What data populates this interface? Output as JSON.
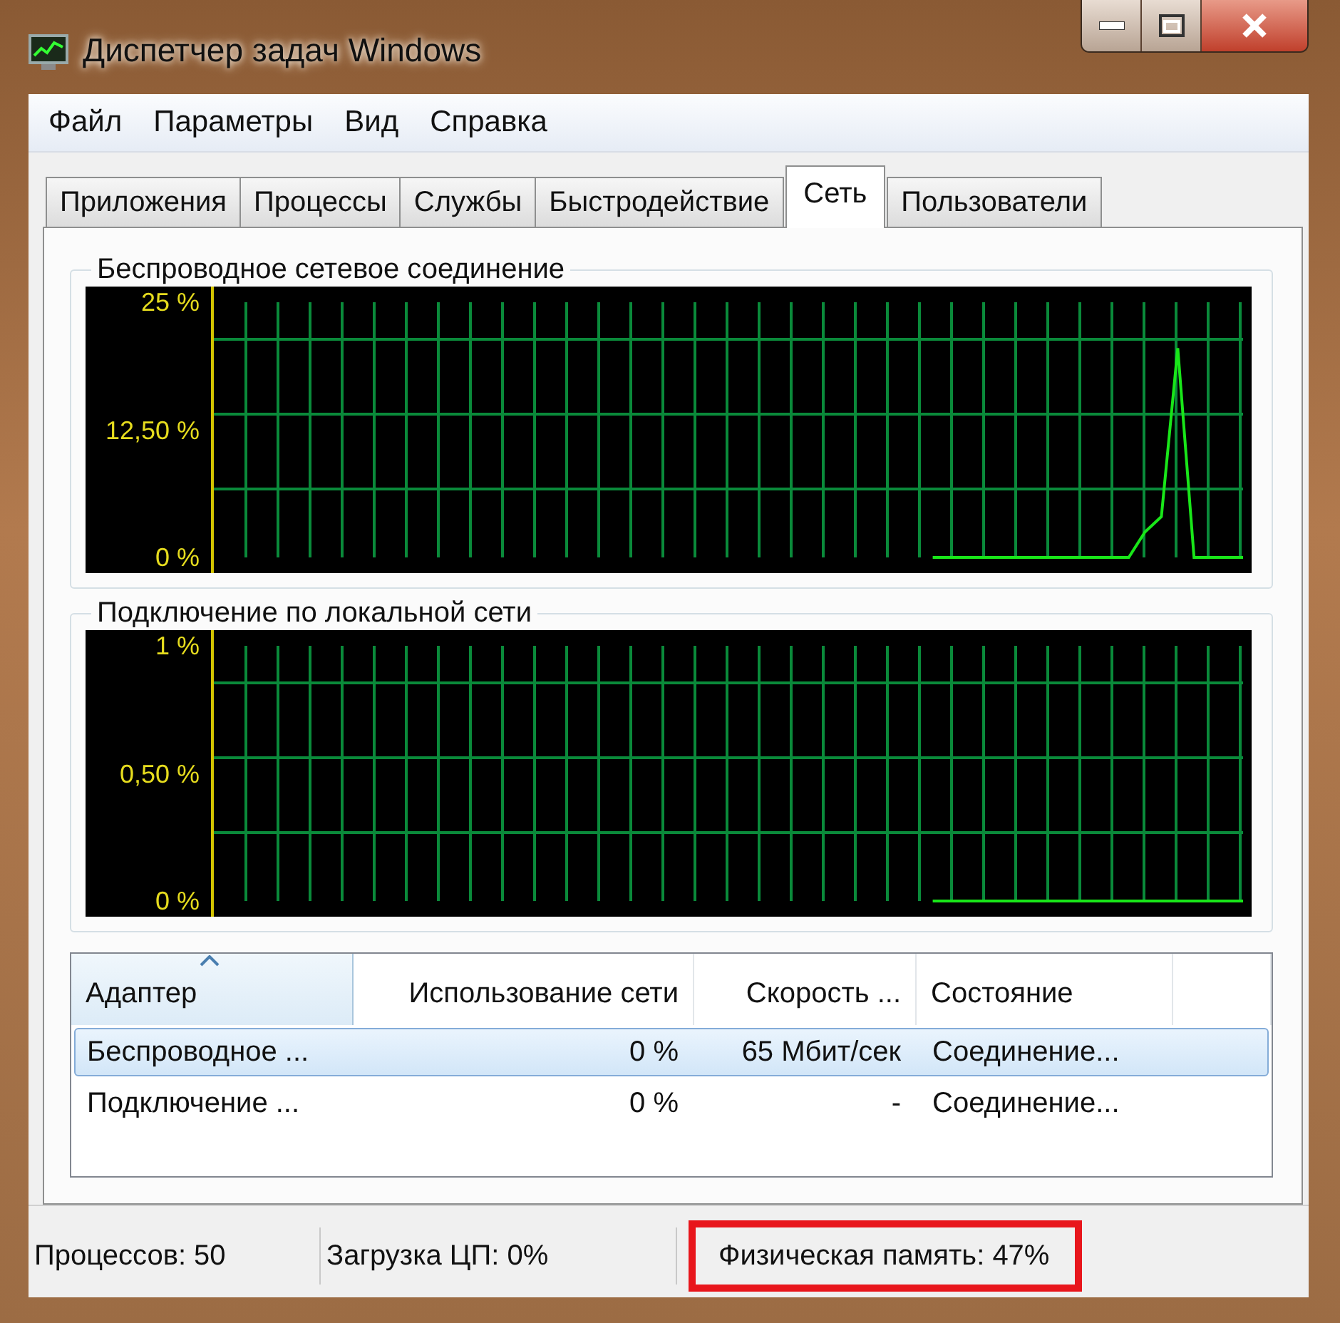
{
  "window": {
    "title": "Диспетчер задач Windows"
  },
  "menu": [
    "Файл",
    "Параметры",
    "Вид",
    "Справка"
  ],
  "tabs": [
    {
      "label": "Приложения",
      "selected": false
    },
    {
      "label": "Процессы",
      "selected": false
    },
    {
      "label": "Службы",
      "selected": false
    },
    {
      "label": "Быстродействие",
      "selected": false
    },
    {
      "label": "Сеть",
      "selected": true
    },
    {
      "label": "Пользователи",
      "selected": false
    }
  ],
  "graphs": [
    {
      "chart_data": {
        "type": "line",
        "title": "Беспроводное сетевое соединение",
        "ylim": [
          0,
          25
        ],
        "yticks": [
          {
            "value": 25,
            "label": "25 %"
          },
          {
            "value": 12.5,
            "label": "12,50 %"
          },
          {
            "value": 0,
            "label": "0 %"
          }
        ],
        "series": [
          {
            "color": "#19e619",
            "values": [
              null,
              null,
              null,
              null,
              null,
              null,
              null,
              null,
              null,
              null,
              null,
              null,
              null,
              null,
              null,
              null,
              null,
              null,
              null,
              null,
              null,
              null,
              null,
              null,
              null,
              null,
              null,
              null,
              null,
              null,
              null,
              null,
              null,
              null,
              null,
              null,
              null,
              null,
              null,
              null,
              null,
              null,
              null,
              null,
              0,
              0,
              0,
              0,
              0,
              0,
              0,
              0,
              0,
              0,
              0,
              0,
              0,
              2.5,
              4,
              20.5,
              0,
              0,
              0,
              0
            ]
          }
        ]
      }
    },
    {
      "chart_data": {
        "type": "line",
        "title": "Подключение по локальной сети",
        "ylim": [
          0,
          1
        ],
        "yticks": [
          {
            "value": 1,
            "label": "1 %"
          },
          {
            "value": 0.5,
            "label": "0,50 %"
          },
          {
            "value": 0,
            "label": "0 %"
          }
        ],
        "series": [
          {
            "color": "#19e619",
            "values": [
              null,
              null,
              null,
              null,
              null,
              null,
              null,
              null,
              null,
              null,
              null,
              null,
              null,
              null,
              null,
              null,
              null,
              null,
              null,
              null,
              null,
              null,
              null,
              null,
              null,
              null,
              null,
              null,
              null,
              null,
              null,
              null,
              null,
              null,
              null,
              null,
              null,
              null,
              null,
              null,
              null,
              null,
              null,
              null,
              0,
              0,
              0,
              0,
              0,
              0,
              0,
              0,
              0,
              0,
              0,
              0,
              0,
              0,
              0,
              0,
              0,
              0,
              0,
              0
            ]
          }
        ]
      }
    }
  ],
  "table": {
    "columns": [
      {
        "label": "Адаптер",
        "sorted": true
      },
      {
        "label": "Использование сети",
        "sorted": false
      },
      {
        "label": "Скорость ...",
        "sorted": false
      },
      {
        "label": "Состояние",
        "sorted": false
      }
    ],
    "rows": [
      {
        "selected": true,
        "cells": [
          "Беспроводное ...",
          "0 %",
          "65 Мбит/сек",
          "Соединение..."
        ]
      },
      {
        "selected": false,
        "cells": [
          "Подключение ...",
          "0 %",
          "-",
          "Соединение..."
        ]
      }
    ]
  },
  "status_bar": [
    {
      "text": "Процессов: 50",
      "highlighted": false
    },
    {
      "text": "Загрузка ЦП: 0%",
      "highlighted": false
    },
    {
      "text": "Физическая память: 47%",
      "highlighted": true
    }
  ]
}
